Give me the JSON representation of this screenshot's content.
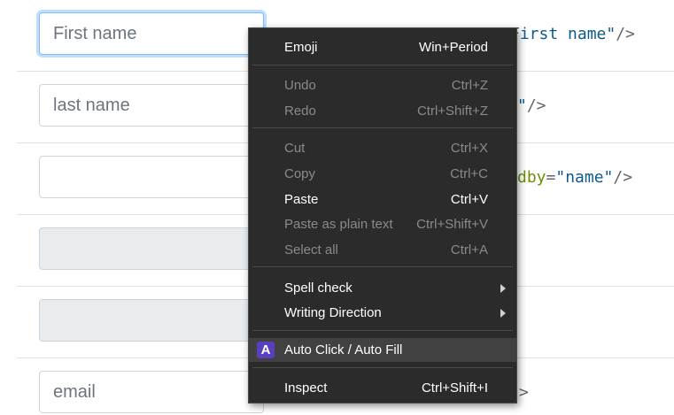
{
  "form": {
    "fields": [
      {
        "placeholder": "First name",
        "value": ""
      },
      {
        "placeholder": "last name",
        "value": ""
      },
      {
        "placeholder": "",
        "value": ""
      },
      {
        "placeholder": "",
        "value": ""
      },
      {
        "placeholder": "",
        "value": ""
      },
      {
        "placeholder": "email",
        "value": ""
      }
    ]
  },
  "code": {
    "row1_str": "First name\"",
    "row1_close": "/>",
    "row2_str": "\"",
    "row2_close": "/>",
    "row3_attr": "dby",
    "row3_eq": "=",
    "row3_str": "\"name\"",
    "row3_close": "/>",
    "row6_close": ">"
  },
  "context_menu": {
    "items": [
      {
        "label": "Emoji",
        "shortcut": "Win+Period",
        "enabled": true
      },
      {
        "label": "Undo",
        "shortcut": "Ctrl+Z",
        "enabled": false
      },
      {
        "label": "Redo",
        "shortcut": "Ctrl+Shift+Z",
        "enabled": false
      },
      {
        "label": "Cut",
        "shortcut": "Ctrl+X",
        "enabled": false
      },
      {
        "label": "Copy",
        "shortcut": "Ctrl+C",
        "enabled": false
      },
      {
        "label": "Paste",
        "shortcut": "Ctrl+V",
        "enabled": true
      },
      {
        "label": "Paste as plain text",
        "shortcut": "Ctrl+Shift+V",
        "enabled": false
      },
      {
        "label": "Select all",
        "shortcut": "Ctrl+A",
        "enabled": false
      },
      {
        "label": "Spell check",
        "shortcut": "",
        "enabled": true
      },
      {
        "label": "Writing Direction",
        "shortcut": "",
        "enabled": true
      },
      {
        "label": "Auto Click / Auto Fill",
        "shortcut": "",
        "enabled": true,
        "icon": "A"
      },
      {
        "label": "Inspect",
        "shortcut": "Ctrl+Shift+I",
        "enabled": true
      }
    ]
  },
  "colors": {
    "menu_bg": "#2b2b2b",
    "menu_highlight": "#414141",
    "extension_icon": "#5a3fbf",
    "focus_ring": "#80bdff"
  }
}
